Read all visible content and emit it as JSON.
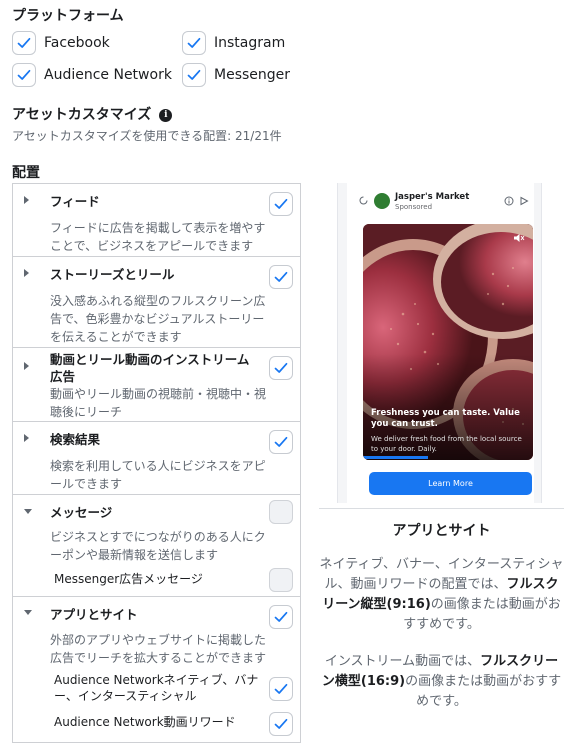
{
  "platform": {
    "title": "プラットフォーム",
    "items": [
      {
        "label": "Facebook",
        "checked": true
      },
      {
        "label": "Instagram",
        "checked": true
      },
      {
        "label": "Audience Network",
        "checked": true
      },
      {
        "label": "Messenger",
        "checked": true
      }
    ]
  },
  "asset_customize": {
    "title": "アセットカスタマイズ",
    "info_icon": "info-icon",
    "subtitle": "アセットカスタマイズを使用できる配置: 21/21件"
  },
  "placements": {
    "title": "配置",
    "rows": [
      {
        "title": "フィード",
        "desc": "フィードに広告を掲載して表示を増やすことで、ビジネスをアピールできます",
        "checked": true,
        "expanded": false
      },
      {
        "title": "ストーリーズとリール",
        "desc": "没入感あふれる縦型のフルスクリーン広告で、色彩豊かなビジュアルストーリーを伝えることができます",
        "checked": true,
        "expanded": false
      },
      {
        "title": "動画とリール動画のインストリーム広告",
        "desc": "動画やリール動画の視聴前・視聴中・視聴後にリーチ",
        "checked": true,
        "expanded": false
      },
      {
        "title": "検索結果",
        "desc": "検索を利用している人にビジネスをアピールできます",
        "checked": true,
        "expanded": false
      },
      {
        "title": "メッセージ",
        "desc": "ビジネスとすでにつながりのある人にクーポンや最新情報を送信します",
        "checked": false,
        "expanded": true,
        "sub": [
          {
            "label": "Messenger広告メッセージ",
            "checked": false
          }
        ]
      },
      {
        "title": "アプリとサイト",
        "desc": "外部のアプリやウェブサイトに掲載した広告でリーチを拡大することができます",
        "checked": true,
        "expanded": true,
        "sub": [
          {
            "label": "Audience Networkネイティブ、バナー、インタースティシャル",
            "checked": true
          },
          {
            "label": "Audience Network動画リワード",
            "checked": true
          }
        ]
      }
    ]
  },
  "preview": {
    "brand": "Jasper's Market",
    "sponsored": "Sponsored",
    "headline": "Freshness you can taste. Value you can trust.",
    "subtext": "We deliver fresh food from the local source to your door. Daily.",
    "cta": "Learn More"
  },
  "recommendation": {
    "title": "アプリとサイト",
    "p1_pre": "ネイティブ、バナー、インタースティシャル、動画リワードの配置では、",
    "p1_b1": "フルスクリーン縦型(9:16)",
    "p1_post": "の画像または動画がおすすめです。",
    "p2_pre": "インストリーム動画では、",
    "p2_b1": "フルスクリーン横型(16:9)",
    "p2_post": "の画像または動画がおすすめです。"
  },
  "colors": {
    "check": "#1877f2",
    "cta": "#1877f2",
    "border": "#ced0d4",
    "muted_text": "#606770"
  }
}
